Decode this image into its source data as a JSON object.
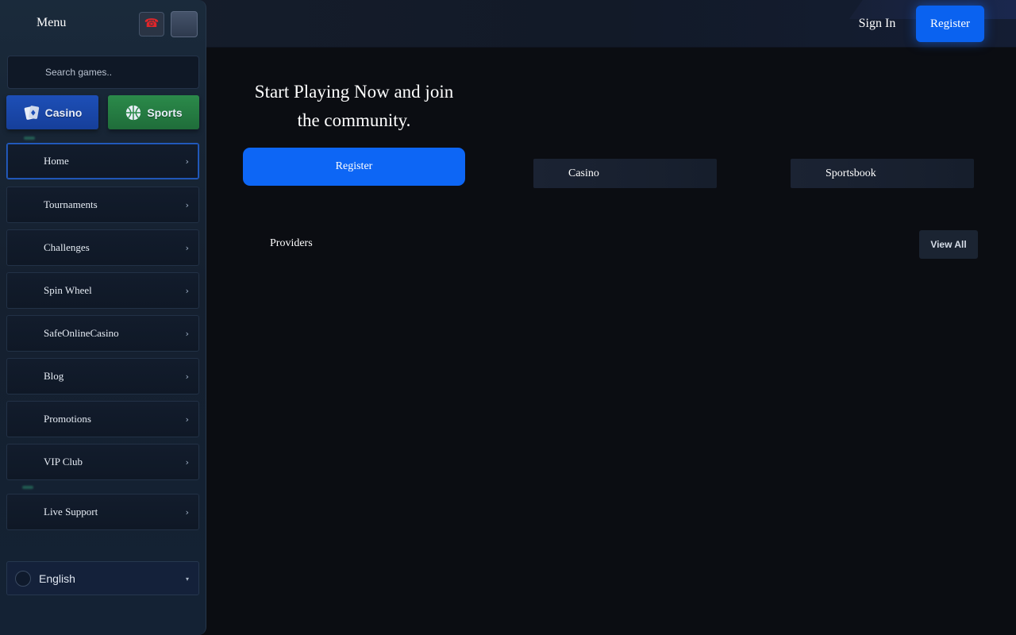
{
  "header": {
    "signin_label": "Sign In",
    "register_label": "Register"
  },
  "sidebar": {
    "menu_title": "Menu",
    "phone_icon": "phone-icon",
    "search_placeholder": "Search games..",
    "tabs": [
      {
        "label": "Casino",
        "icon": "cards-icon",
        "color": "#1d4fb7"
      },
      {
        "label": "Sports",
        "icon": "basketball-icon",
        "color": "#2b8a4a"
      }
    ],
    "items": [
      {
        "label": "Home",
        "active": true
      },
      {
        "label": "Tournaments"
      },
      {
        "label": "Challenges"
      },
      {
        "label": "Spin Wheel"
      },
      {
        "label": "SafeOnlineCasino"
      },
      {
        "label": "Blog"
      },
      {
        "label": "Promotions"
      },
      {
        "label": "VIP Club"
      },
      {
        "label": "Live Support"
      }
    ],
    "chevron": "›",
    "language": {
      "selected": "English",
      "caret": "▾"
    }
  },
  "main": {
    "hero_title": "Start Playing Now and join the community.",
    "register_label": "Register",
    "quick_links": [
      {
        "label": "Casino"
      },
      {
        "label": "Sportsbook"
      }
    ],
    "providers_title": "Providers",
    "view_all_label": "View All"
  },
  "colors": {
    "accent": "#0a62f0",
    "background": "#0b0d12",
    "sidebar": "#15202f"
  }
}
